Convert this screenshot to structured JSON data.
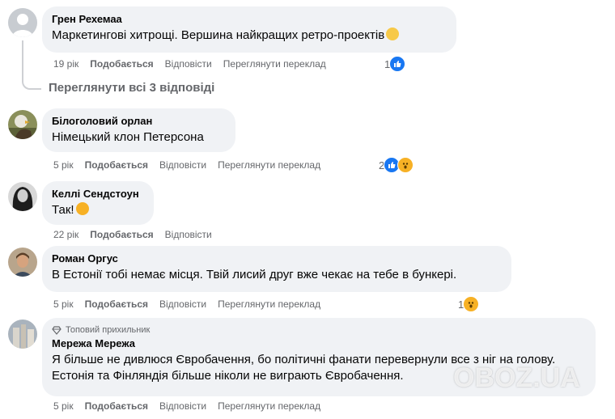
{
  "comments": [
    {
      "author": "Грен Рехемаа",
      "text": "Маркетингові хитрощі. Вершина найкращих ретро-проектів",
      "time": "19 рік",
      "like": "Подобається",
      "reply": "Відповісти",
      "translate": "Переглянути переклад",
      "reaction_count": "1",
      "reactions": [
        "like-icon"
      ]
    },
    {
      "author": "Білоголовий орлан",
      "text": "Німецький клон Петерсона",
      "time": "5 рік",
      "like": "Подобається",
      "reply": "Відповісти",
      "translate": "Переглянути переклад",
      "reaction_count": "2",
      "reactions": [
        "like-icon",
        "wow-icon"
      ]
    },
    {
      "author": "Келлі Сендстоун",
      "text": "Так!",
      "time": "22 рік",
      "like": "Подобається",
      "reply": "Відповісти"
    },
    {
      "author": "Роман Оргус",
      "text": "В Естонії тобі немає місця. Твій лисий друг вже чекає на тебе в бункері.",
      "time": "5 рік",
      "like": "Подобається",
      "reply": "Відповісти",
      "translate": "Переглянути переклад",
      "reaction_count": "1",
      "reactions": [
        "wow-icon"
      ]
    },
    {
      "badge": "Топовий прихильник",
      "author": "Мережа Мережа",
      "text": "Я більше не дивлюся Євробачення, бо політичні фанати перевернули все з ніг на голову. Естонія та Фінляндія більше ніколи не виграють Євробачення.",
      "time": "5 рік",
      "like": "Подобається",
      "reply": "Відповісти",
      "translate": "Переглянути переклад"
    }
  ],
  "view_replies": "Переглянути всі 3 відповіді",
  "watermark": "OBOZ.UA",
  "colors": {
    "bubble": "#f0f2f5",
    "meta": "#65676b",
    "like_blue": "#1877f2",
    "wow_yellow": "#f7b125"
  }
}
